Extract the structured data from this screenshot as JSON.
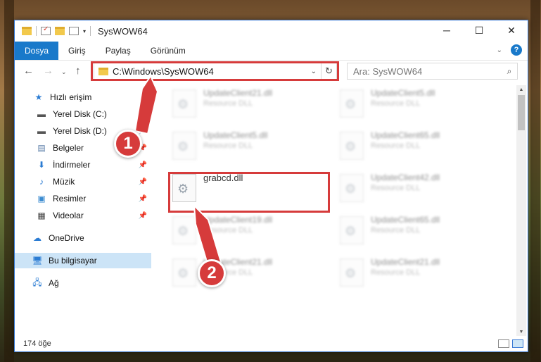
{
  "window": {
    "title": "SysWOW64",
    "controls": {
      "minimize": "─",
      "maximize": "☐",
      "close": "✕"
    }
  },
  "ribbon": {
    "tabs": [
      "Dosya",
      "Giriş",
      "Paylaş",
      "Görünüm"
    ],
    "active_tab": "Dosya",
    "help": "?"
  },
  "nav": {
    "address": "C:\\Windows\\SysWOW64",
    "search_placeholder": "Ara: SysWOW64"
  },
  "sidebar": {
    "items": [
      {
        "label": "Hızlı erişim",
        "icon": "star-icon",
        "pinned": false
      },
      {
        "label": "Yerel Disk (C:)",
        "icon": "drive-icon",
        "pinned": true
      },
      {
        "label": "Yerel Disk (D:)",
        "icon": "drive-icon",
        "pinned": true
      },
      {
        "label": "Belgeler",
        "icon": "documents-icon",
        "pinned": true
      },
      {
        "label": "İndirmeler",
        "icon": "download-icon",
        "pinned": true
      },
      {
        "label": "Müzik",
        "icon": "music-icon",
        "pinned": true
      },
      {
        "label": "Resimler",
        "icon": "pictures-icon",
        "pinned": true
      },
      {
        "label": "Videolar",
        "icon": "videos-icon",
        "pinned": true
      },
      {
        "label": "OneDrive",
        "icon": "cloud-icon",
        "pinned": false
      },
      {
        "label": "Bu bilgisayar",
        "icon": "computer-icon",
        "pinned": false,
        "selected": true
      },
      {
        "label": "Ağ",
        "icon": "network-icon",
        "pinned": false
      }
    ]
  },
  "files": [
    {
      "name": "UpdateClient21.dll",
      "type": "Resource DLL",
      "blurred": true
    },
    {
      "name": "UpdateClient5.dll",
      "type": "Resource DLL",
      "blurred": true
    },
    {
      "name": "UpdateClient5.dll",
      "type": "Resource DLL",
      "blurred": true
    },
    {
      "name": "UpdateClient65.dll",
      "type": "Resource DLL",
      "blurred": true
    },
    {
      "name": "grabcd.dll",
      "type": "",
      "blurred": false
    },
    {
      "name": "UpdateClient42.dll",
      "type": "Resource DLL",
      "blurred": true
    },
    {
      "name": "UpdateClient19.dll",
      "type": "Resource DLL",
      "blurred": true
    },
    {
      "name": "UpdateClient65.dll",
      "type": "Resource DLL",
      "blurred": true
    },
    {
      "name": "UpdateClient21.dll",
      "type": "Resource DLL",
      "blurred": true
    },
    {
      "name": "UpdateClient21.dll",
      "type": "Resource DLL",
      "blurred": true
    }
  ],
  "status": {
    "count": "174 öğe"
  },
  "annotations": {
    "step1": "1",
    "step2": "2",
    "color": "#d63b3b"
  }
}
